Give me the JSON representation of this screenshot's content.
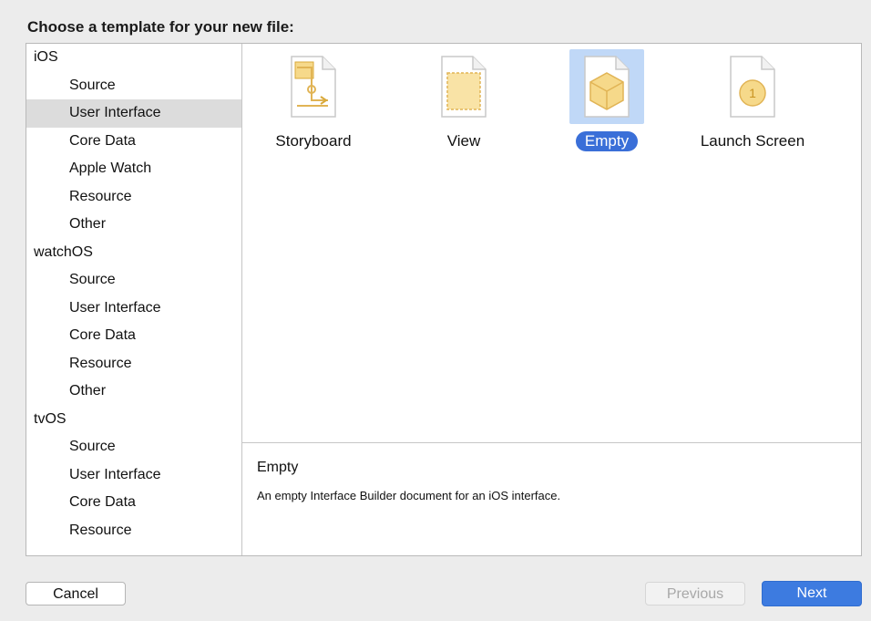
{
  "prompt": "Choose a template for your new file:",
  "sidebar": {
    "platforms": [
      {
        "name": "iOS",
        "items": [
          "Source",
          "User Interface",
          "Core Data",
          "Apple Watch",
          "Resource",
          "Other"
        ]
      },
      {
        "name": "watchOS",
        "items": [
          "Source",
          "User Interface",
          "Core Data",
          "Resource",
          "Other"
        ]
      },
      {
        "name": "tvOS",
        "items": [
          "Source",
          "User Interface",
          "Core Data",
          "Resource"
        ]
      }
    ],
    "selected": "iOS / User Interface"
  },
  "templates": [
    {
      "label": "Storyboard",
      "icon": "storyboard-doc-icon"
    },
    {
      "label": "View",
      "icon": "view-doc-icon"
    },
    {
      "label": "Empty",
      "icon": "empty-cube-icon",
      "selected": true
    },
    {
      "label": "Launch Screen",
      "icon": "launch-screen-doc-icon"
    }
  ],
  "detail": {
    "title": "Empty",
    "description": "An empty Interface Builder document for an iOS interface."
  },
  "buttons": {
    "cancel": "Cancel",
    "previous": "Previous",
    "next": "Next"
  },
  "colors": {
    "accent": "#3a6fd8",
    "selection_tile": "#c0d8f7",
    "icon_yellow": "#f6d98a"
  }
}
